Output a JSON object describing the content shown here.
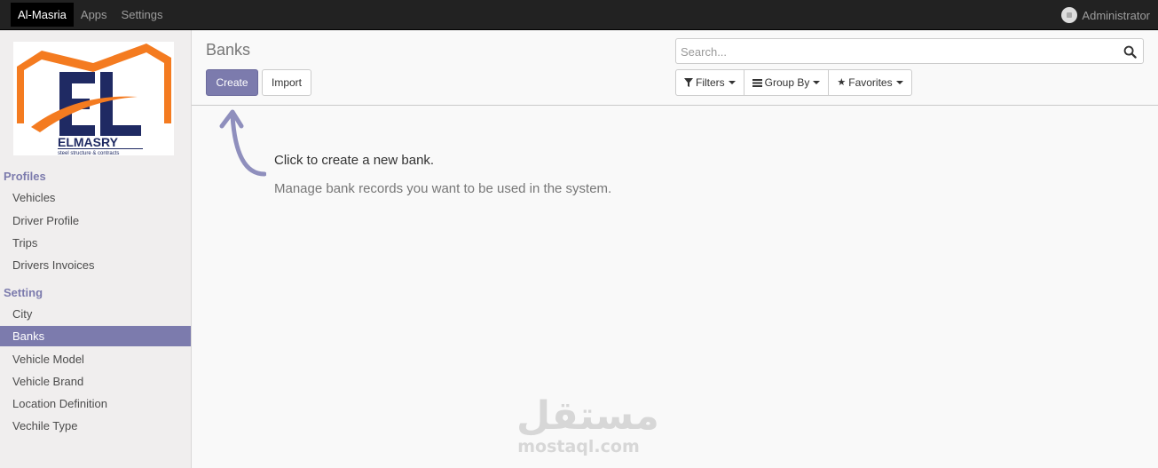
{
  "topbar": {
    "menu": [
      "Al-Masria",
      "Apps",
      "Settings"
    ],
    "user_name": "Administrator"
  },
  "logo": {
    "initials": "EL",
    "company_name": "ELMASRY",
    "tagline": "steel structure & contracts",
    "colors": {
      "orange": "#f47b20",
      "navy": "#1f2a63"
    }
  },
  "sidebar": {
    "sections": [
      {
        "title": "Profiles",
        "items": [
          "Vehicles",
          "Driver Profile",
          "Trips",
          "Drivers Invoices"
        ]
      },
      {
        "title": "Setting",
        "items": [
          "City",
          "Banks",
          "Vehicle Model",
          "Vehicle Brand",
          "Location Definition",
          "Vechile Type"
        ]
      }
    ],
    "active_item": "Banks"
  },
  "main": {
    "title": "Banks",
    "create_label": "Create",
    "import_label": "Import",
    "search_placeholder": "Search...",
    "filters_label": "Filters",
    "group_by_label": "Group By",
    "favorites_label": "Favorites",
    "help_title": "Click to create a new bank.",
    "help_description": "Manage bank records you want to be used in the system."
  },
  "watermark": {
    "arabic": "مستقل",
    "latin": "mostaql.com"
  },
  "colors": {
    "accent": "#7c7bad",
    "topbar": "#222222"
  }
}
